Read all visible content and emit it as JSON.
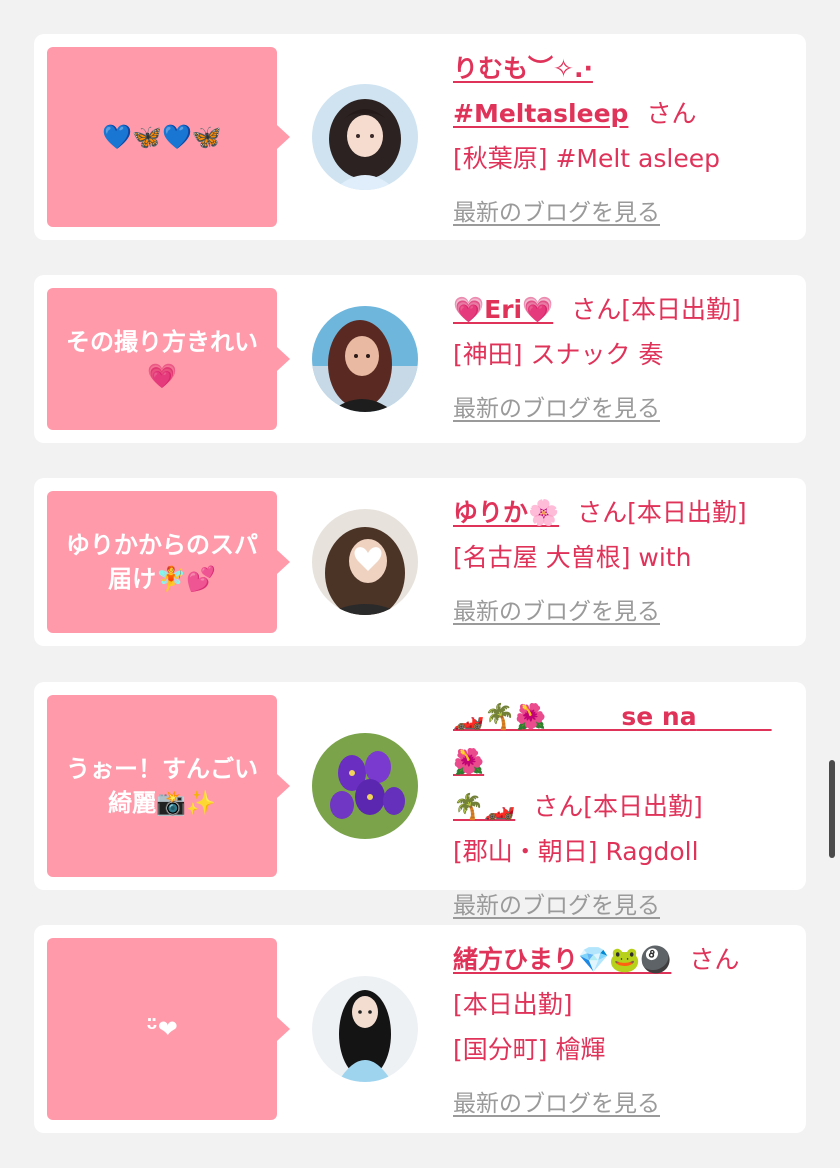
{
  "posts": [
    {
      "bubble": "💙🦋💙🦋",
      "name": "りむも︶✧.·\n#Meltasleep",
      "name_suffix": "さん",
      "status": "",
      "shop": "[秋葉原] #Melt asleep",
      "blog_link": "最新のブログを見る",
      "avatar_desc": "girl-avatar"
    },
    {
      "bubble": "その撮り方きれい\n💗",
      "name": "💗Eri💗",
      "name_suffix": "さん",
      "status": "[本日出勤]",
      "shop": "[神田] スナック 奏",
      "blog_link": "最新のブログを見る",
      "avatar_desc": "girl-avatar"
    },
    {
      "bubble": "ゆりかからのスパ\n届け🧚💕",
      "name": "ゆりか🌸",
      "name_suffix": "さん",
      "status": "[本日出勤]",
      "shop": "[名古屋 大曽根] with",
      "blog_link": "最新のブログを見る",
      "avatar_desc": "girl-avatar"
    },
    {
      "bubble": "うぉー！すんごい\n綺麗📸✨",
      "name": "🏎️🌴🌺　　　se na　　　🌺\n🌴🏎️",
      "name_suffix": "さん",
      "status": "[本日出勤]",
      "shop": "[郡山・朝日] Ragdoll",
      "blog_link": "最新のブログを見る",
      "avatar_desc": "flower-avatar"
    },
    {
      "bubble": "ᵕ̈❤",
      "name": "緒方ひまり💎🐸🎱",
      "name_suffix": "さん",
      "status": "[本日出勤]",
      "shop": "[国分町] 檜輝",
      "blog_link": "最新のブログを見る",
      "avatar_desc": "girl-avatar"
    }
  ],
  "colors": {
    "accent": "#e0335a",
    "bubble": "#ff9aab",
    "link_gray": "#9a9a9a",
    "background": "#f2f2f2"
  }
}
